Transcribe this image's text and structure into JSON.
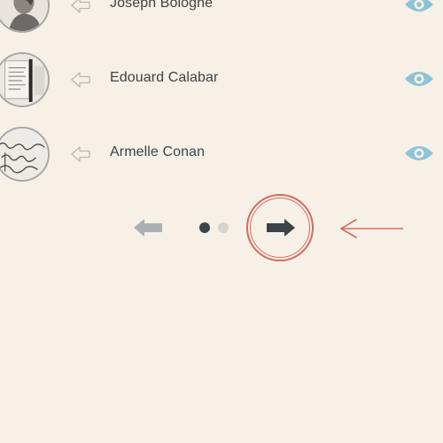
{
  "list": {
    "items": [
      {
        "name": "Joseph Bologne",
        "avatar_icon": "portrait-thumbnail",
        "action_icon": "share-arrow-icon",
        "view_icon": "eye-icon"
      },
      {
        "name": "Edouard Calabar",
        "avatar_icon": "document-thumbnail",
        "action_icon": "share-arrow-icon",
        "view_icon": "eye-icon"
      },
      {
        "name": "Armelle Conan",
        "avatar_icon": "handwriting-thumbnail",
        "action_icon": "share-arrow-icon",
        "view_icon": "eye-icon"
      }
    ]
  },
  "pagination": {
    "prev_icon": "arrow-left-icon",
    "next_icon": "arrow-right-icon",
    "pages": 2,
    "current_page": 1
  },
  "colors": {
    "background": "#f6f0e6",
    "text": "#3c4448",
    "eye": "#8cc3d6",
    "highlight": "#d46a5e",
    "disabled_arrow": "#a9b1b4",
    "dot_active": "#3b4448",
    "dot_inactive": "#d6d4ce"
  }
}
